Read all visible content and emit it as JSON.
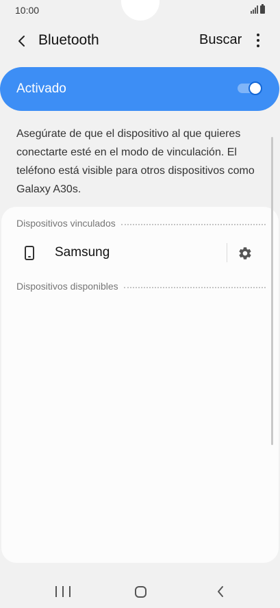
{
  "status_bar": {
    "time": "10:00"
  },
  "app_bar": {
    "title": "Bluetooth",
    "search_label": "Buscar"
  },
  "master_switch": {
    "label": "Activado",
    "on": true
  },
  "description": "Asegúrate de que el dispositivo al que quieres conectarte esté en el modo de vinculación. El teléfono está visible para otros dispositivos como Galaxy A30s.",
  "paired_section": {
    "title": "Dispositivos vinculados",
    "devices": [
      {
        "name": "Samsung",
        "icon": "phone-icon"
      }
    ]
  },
  "available_section": {
    "title": "Dispositivos disponibles"
  },
  "colors": {
    "accent": "#3d8ef5",
    "toggle_outline": "#1266d6",
    "background": "#f1f1f1",
    "card": "#fcfcfc"
  }
}
